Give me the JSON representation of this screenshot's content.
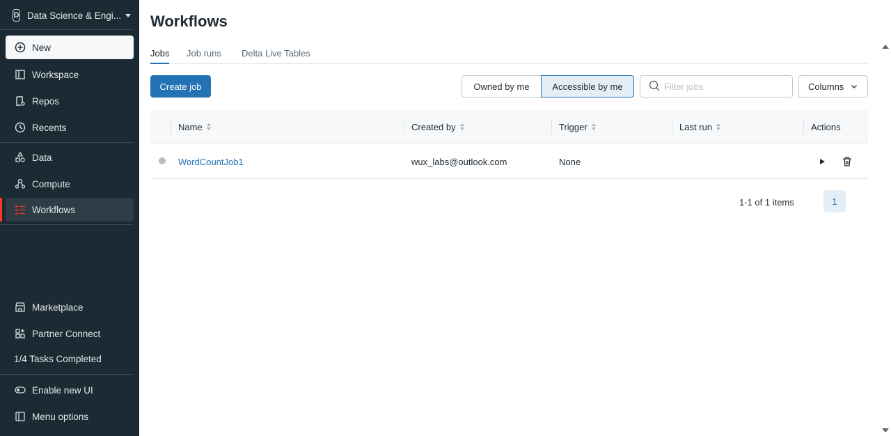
{
  "sidebar": {
    "workspace_badge": "D",
    "workspace_name": "Data Science & Engi...",
    "new_label": "New",
    "items": [
      {
        "label": "Workspace",
        "icon": "workspace-icon"
      },
      {
        "label": "Repos",
        "icon": "repos-icon"
      },
      {
        "label": "Recents",
        "icon": "clock-icon"
      },
      {
        "label": "Data",
        "icon": "data-icon"
      },
      {
        "label": "Compute",
        "icon": "compute-icon"
      },
      {
        "label": "Workflows",
        "icon": "workflows-icon"
      }
    ],
    "bottom_items": [
      {
        "label": "Marketplace",
        "icon": "marketplace-icon"
      },
      {
        "label": "Partner Connect",
        "icon": "partner-connect-icon"
      }
    ],
    "tasks_label": "1/4 Tasks Completed",
    "footer_items": [
      {
        "label": "Enable new UI",
        "icon": "toggle-icon"
      },
      {
        "label": "Menu options",
        "icon": "panel-icon"
      }
    ],
    "accent_color": "#ff3621"
  },
  "main": {
    "title": "Workflows",
    "tabs": [
      {
        "label": "Jobs",
        "active": true
      },
      {
        "label": "Job runs",
        "active": false
      },
      {
        "label": "Delta Live Tables",
        "active": false
      }
    ],
    "create_button": "Create job",
    "filter_owned": "Owned by me",
    "filter_accessible": "Accessible by me",
    "search_placeholder": "Filter jobs",
    "columns_button": "Columns",
    "table": {
      "headers": [
        "Name",
        "Created by",
        "Trigger",
        "Last run",
        "Actions"
      ],
      "rows": [
        {
          "name": "WordCountJob1",
          "created_by": "wux_labs@outlook.com",
          "trigger": "None",
          "last_run": ""
        }
      ]
    },
    "pagination": {
      "summary": "1-1 of 1 items",
      "current_page": "1"
    }
  }
}
